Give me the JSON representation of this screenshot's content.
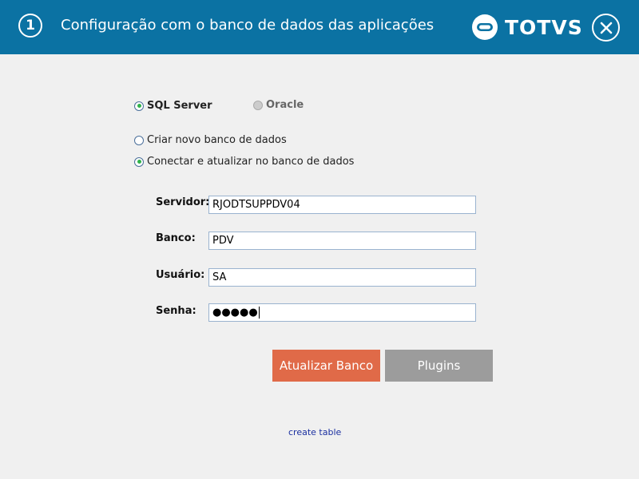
{
  "header": {
    "step_number": "1",
    "title": "Configuração com o banco de dados das aplicações",
    "logo_text": "TOTVS",
    "background_color": "#0b72a3"
  },
  "db_type": {
    "options": [
      {
        "label": "SQL Server",
        "selected": true,
        "enabled": true
      },
      {
        "label": "Oracle",
        "selected": false,
        "enabled": false
      }
    ]
  },
  "db_action": {
    "options": [
      {
        "label": "Criar novo banco de dados",
        "selected": false
      },
      {
        "label": "Conectar e atualizar no banco de dados",
        "selected": true
      }
    ]
  },
  "form": {
    "server_label": "Servidor:",
    "server_value": "RJODTSUPPDV04",
    "database_label": "Banco:",
    "database_value": "PDV",
    "user_label": "Usuário:",
    "user_value": "SA",
    "password_label": "Senha:",
    "password_value": "●●●●●"
  },
  "buttons": {
    "update_label": "Atualizar Banco",
    "update_color": "#e06a48",
    "plugins_label": "Plugins",
    "plugins_color": "#9c9c9c"
  },
  "links": {
    "create_table": "create table"
  }
}
